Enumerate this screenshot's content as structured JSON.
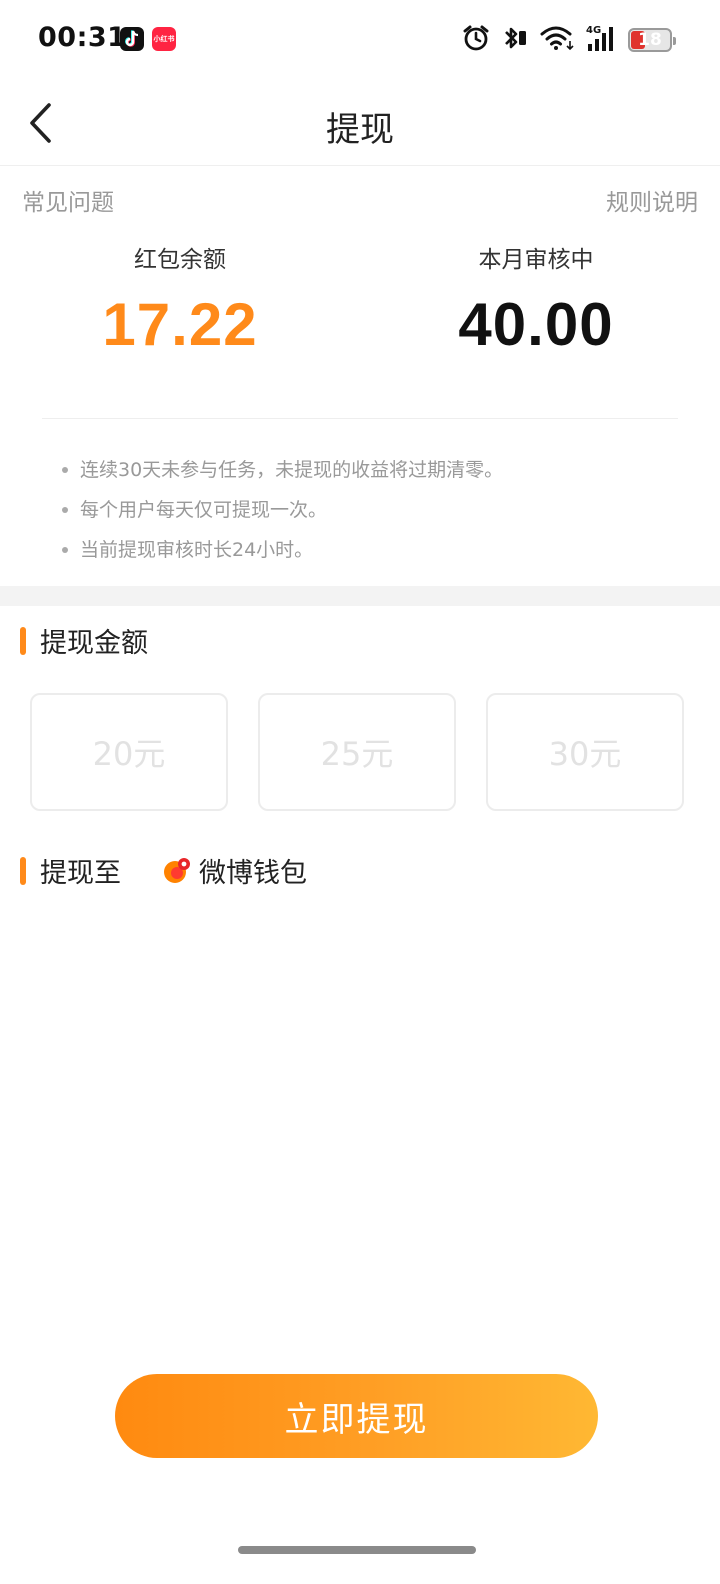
{
  "status_bar": {
    "time": "00:31",
    "app_icons": [
      "tiktok-icon",
      "xiaohongshu-icon"
    ],
    "xhs_label": "小红书",
    "icons": [
      "alarm-icon",
      "bluetooth-icon",
      "wifi-icon",
      "signal-4g-icon",
      "battery-icon"
    ],
    "network": "4G",
    "battery_level": "18"
  },
  "nav": {
    "title": "提现",
    "back_icon": "chevron-left-icon"
  },
  "links": {
    "faq": "常见问题",
    "rules": "规则说明"
  },
  "balances": {
    "red_packet": {
      "label": "红包余额",
      "value": "17.22"
    },
    "reviewing": {
      "label": "本月审核中",
      "value": "40.00"
    }
  },
  "notes": [
    "连续30天未参与任务，未提现的收益将过期清零。",
    "每个用户每天仅可提现一次。",
    "当前提现审核时长24小时。"
  ],
  "withdraw_amount": {
    "title": "提现金额",
    "options": [
      "20元",
      "25元",
      "30元"
    ]
  },
  "withdraw_to": {
    "title": "提现至",
    "wallet_icon": "weibo-wallet-icon",
    "wallet_name": "微博钱包"
  },
  "action": {
    "withdraw_label": "立即提现"
  },
  "colors": {
    "accent": "#ff8a1a",
    "button_gradient_start": "#ff8a10",
    "button_gradient_end": "#ffb833"
  }
}
